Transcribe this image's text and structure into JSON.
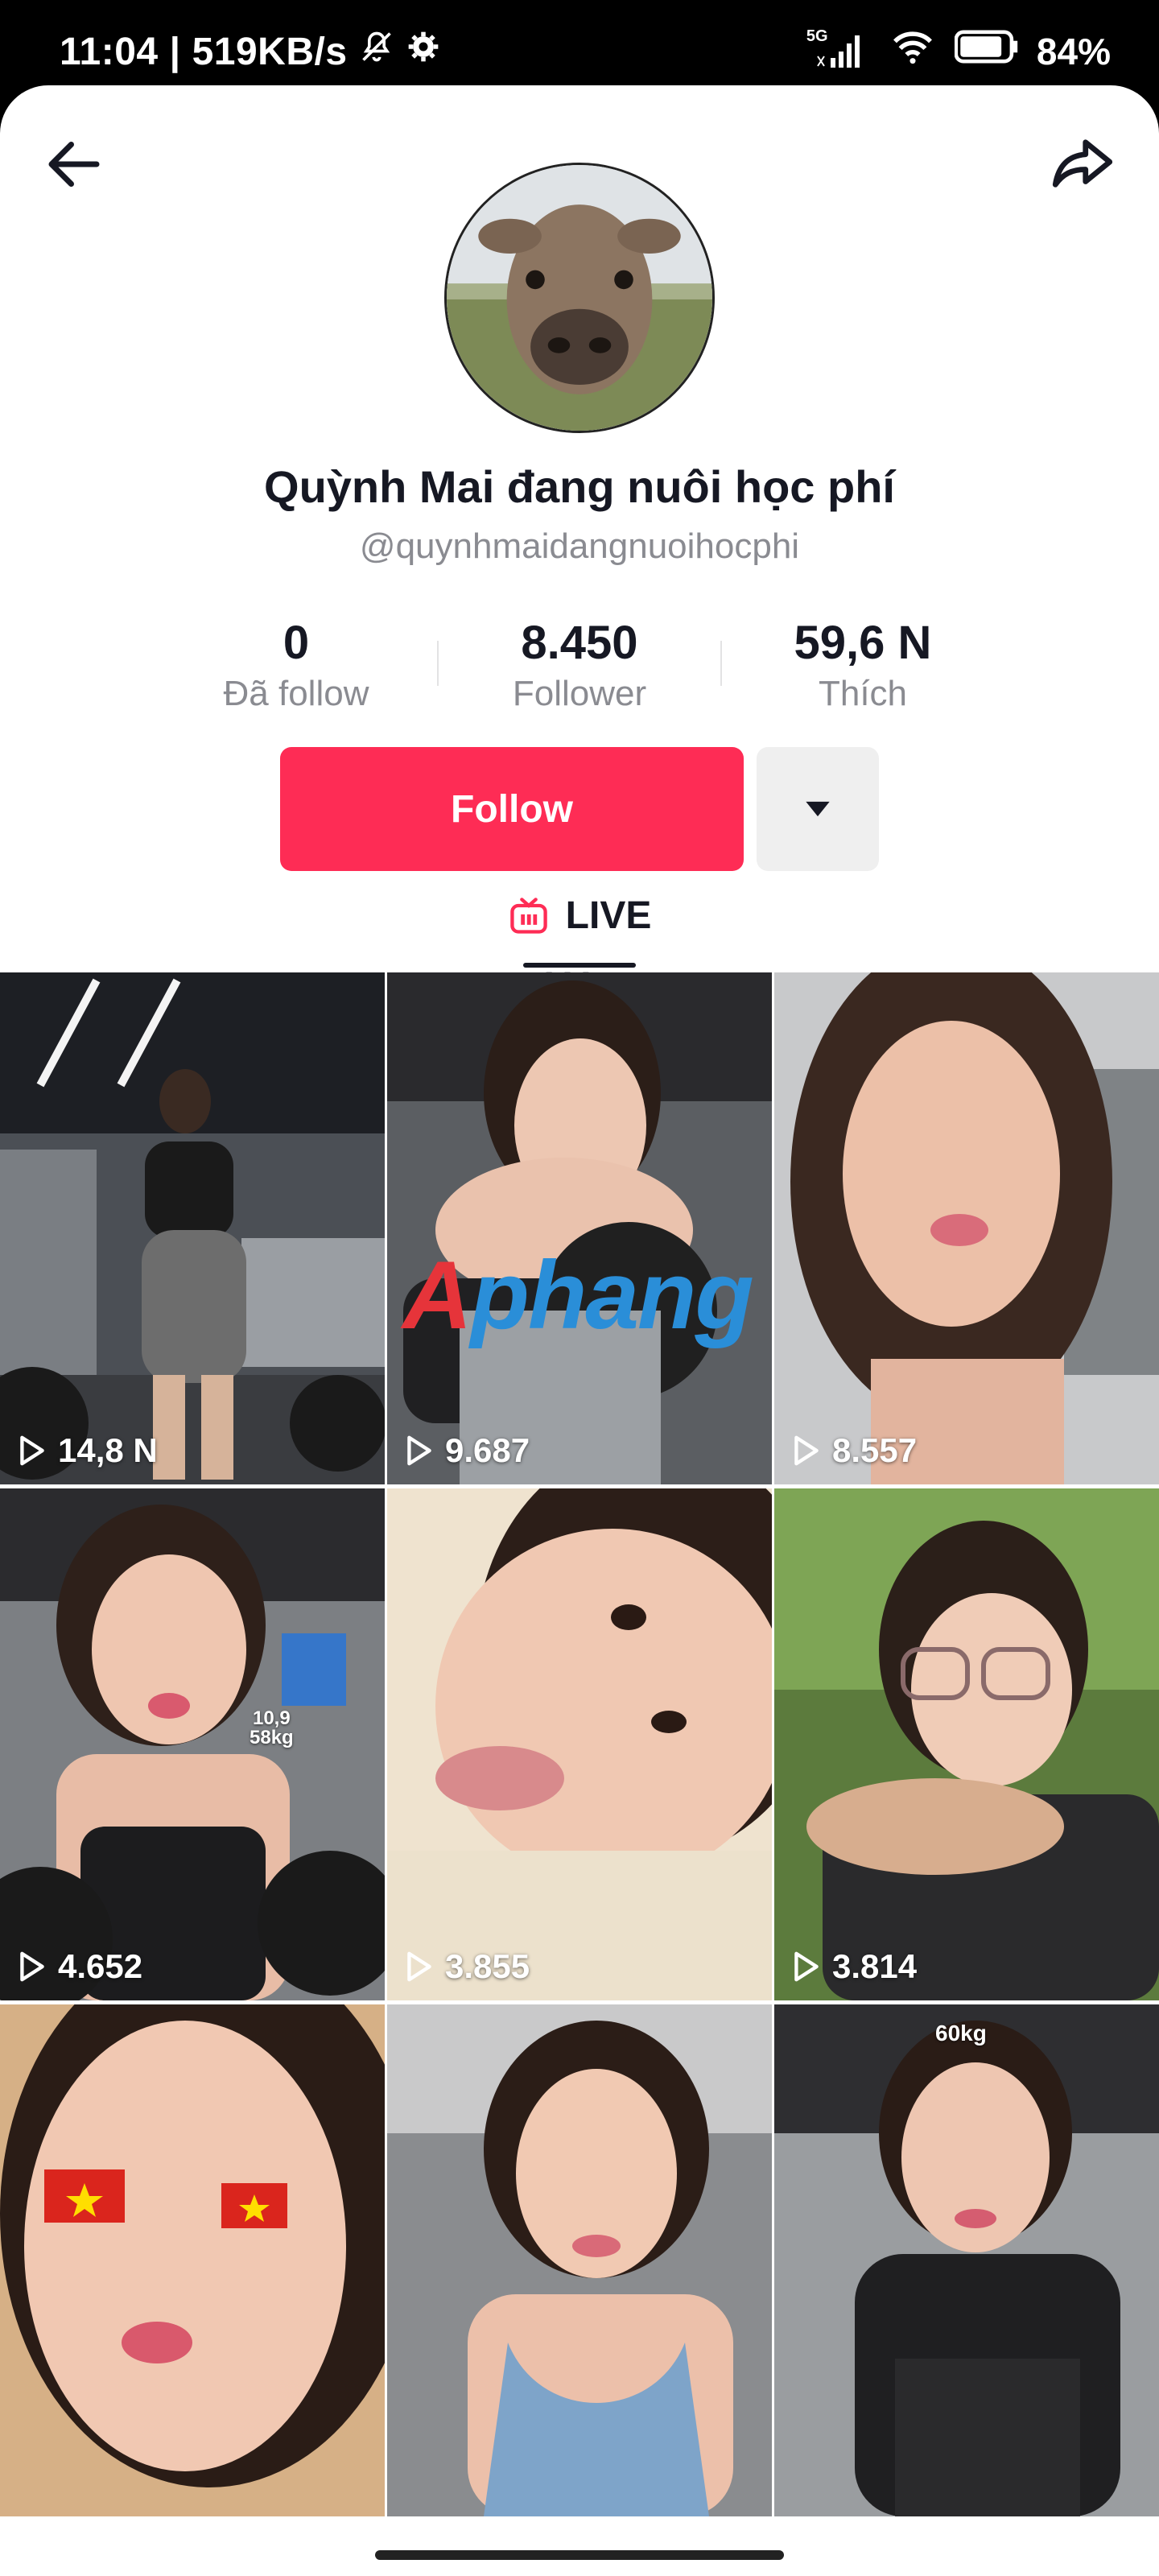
{
  "status_bar": {
    "time": "11:04",
    "separator": "|",
    "network_speed": "519KB/s",
    "network_type": "5G",
    "battery": "84%",
    "icons": [
      "bell-muted-icon",
      "settings-gear-icon",
      "signal-icon",
      "wifi-icon",
      "battery-icon"
    ]
  },
  "header": {
    "back_icon": "arrow-left-icon",
    "share_icon": "share-arrow-icon"
  },
  "profile": {
    "display_name": "Quỳnh Mai đang nuôi học phí",
    "username": "@quynhmaidangnuoihocphi",
    "avatar_desc": "buffalo calf photo"
  },
  "stats": [
    {
      "value": "0",
      "label": "Đã follow"
    },
    {
      "value": "8.450",
      "label": "Follower"
    },
    {
      "value": "59,6 N",
      "label": "Thích"
    }
  ],
  "actions": {
    "follow_label": "Follow",
    "more_icon": "triangle-down-icon"
  },
  "live": {
    "label": "LIVE",
    "icon": "tv-icon"
  },
  "tabs": {
    "videos_icon": "grid-bars-icon"
  },
  "watermark": {
    "part_a": "A",
    "part_b": "phang"
  },
  "videos": [
    {
      "views": "14,8 N"
    },
    {
      "views": "9.687"
    },
    {
      "views": "8.557"
    },
    {
      "views": "4.652",
      "overlay": [
        "10,9",
        "58kg"
      ]
    },
    {
      "views": "3.855"
    },
    {
      "views": "3.814"
    },
    {
      "views": ""
    },
    {
      "views": ""
    },
    {
      "views": "",
      "overlay": [
        "60kg"
      ]
    }
  ],
  "colors": {
    "follow": "#fe2c55",
    "text_primary": "#161823",
    "text_secondary": "#8a8b91"
  }
}
